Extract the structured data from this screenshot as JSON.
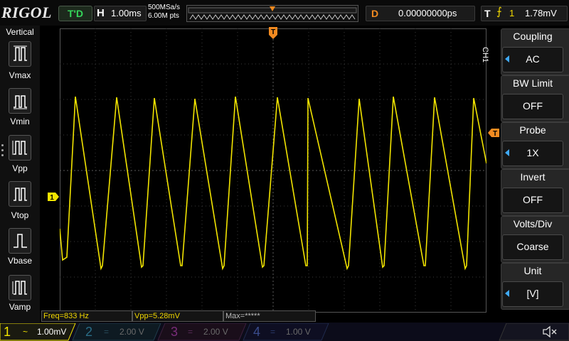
{
  "top": {
    "logo": "RIGOL",
    "trigger_status": "T'D",
    "horizontal_letter": "H",
    "timebase": "1.00ms",
    "sample_rate": "500MSa/s",
    "memory_depth": "6.00M pts",
    "delay_letter": "D",
    "delay": "0.00000000ps",
    "trigger_letter": "T",
    "trigger_source": "1",
    "trigger_level": "1.78mV"
  },
  "left": {
    "title": "Vertical",
    "items": [
      {
        "label": "Vmax"
      },
      {
        "label": "Vmin"
      },
      {
        "label": "Vpp"
      },
      {
        "label": "Vtop"
      },
      {
        "label": "Vbase"
      },
      {
        "label": "Vamp"
      }
    ]
  },
  "markers": {
    "trigger_pos": "T",
    "channel_marker": "1",
    "level_marker": "T"
  },
  "right": {
    "tab": "CH1",
    "sections": [
      {
        "title": "Coupling",
        "value": "AC",
        "arrow": true
      },
      {
        "title": "BW Limit",
        "value": "OFF",
        "arrow": false
      },
      {
        "title": "Probe",
        "value": "1X",
        "arrow": true
      },
      {
        "title": "Invert",
        "value": "OFF",
        "arrow": false
      },
      {
        "title": "Volts/Div",
        "value": "Coarse",
        "arrow": false
      },
      {
        "title": "Unit",
        "value": "[V]",
        "arrow": true
      }
    ]
  },
  "measurements": {
    "freq": "Freq=833 Hz",
    "vpp": "Vpp=5.28mV",
    "max": "Max=*****"
  },
  "channels": [
    {
      "num": "1",
      "scale": "1.00mV",
      "color": "#f2e400"
    },
    {
      "num": "2",
      "scale": "2.00 V",
      "color": "#2fa0c8"
    },
    {
      "num": "3",
      "scale": "2.00 V",
      "color": "#c040c0"
    },
    {
      "num": "4",
      "scale": "1.00 V",
      "color": "#3060d0"
    }
  ],
  "colors": {
    "ch1": "#f2e400",
    "accent_orange": "#f28a20",
    "grid": "#3a3a3a"
  }
}
